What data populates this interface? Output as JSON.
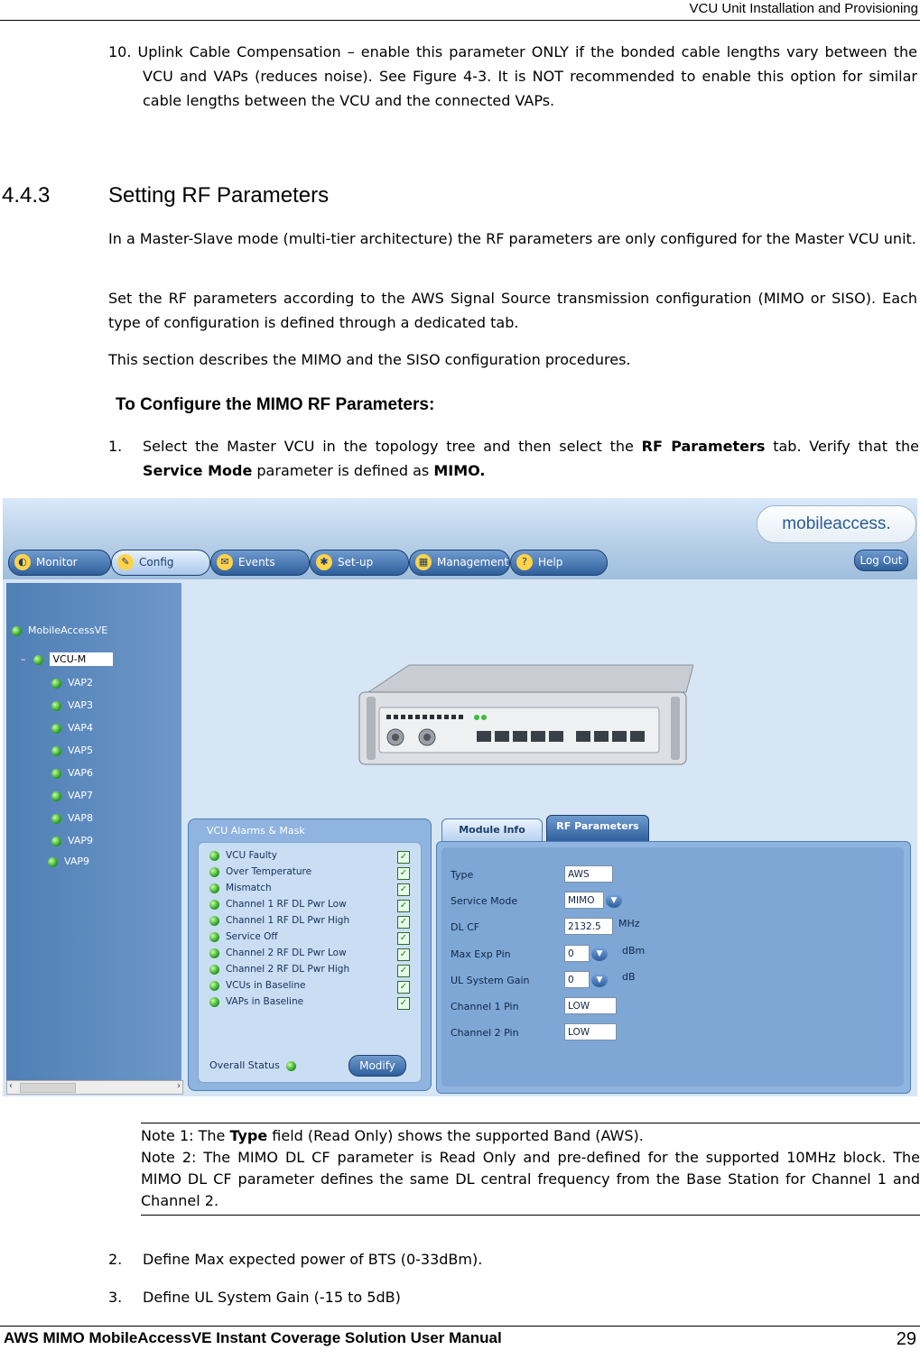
{
  "header": {
    "title": "VCU Unit Installation and Provisioning"
  },
  "step10": {
    "text": "10. Uplink Cable Compensation – enable this parameter ONLY if the bonded cable lengths vary between the VCU and VAPs (reduces noise). See Figure 4-3. It is NOT recommended to enable this option for similar cable lengths between the VCU and the connected VAPs."
  },
  "section": {
    "number": "4.4.3",
    "title": "Setting RF Parameters"
  },
  "paragraphs": [
    "In a Master-Slave mode (multi-tier architecture) the RF parameters are only configured for the Master VCU unit.",
    "Set the RF parameters according to the AWS Signal Source transmission configuration (MIMO or SISO). Each type of configuration is defined through a dedicated tab.",
    "This section describes the MIMO and the SISO configuration procedures."
  ],
  "procedure_title": "To Configure the MIMO RF Parameters:",
  "step1": {
    "num": "1.",
    "a": "Select the Master VCU in the topology tree and then select the ",
    "b": "RF Parameters",
    "c": " tab. Verify that the ",
    "d": "Service Mode",
    "e": " parameter is defined as ",
    "f": "MIMO."
  },
  "screenshot": {
    "logo": "mobileaccess.",
    "nav": [
      "Monitor",
      "Config",
      "Events",
      "Set-up",
      "Management",
      "Help"
    ],
    "logout": "Log Out",
    "tree_root": "MobileAccessVE",
    "tree_selected": "VCU-M",
    "tree_items": [
      "VAP2",
      "VAP3",
      "VAP4",
      "VAP5",
      "VAP6",
      "VAP7",
      "VAP8",
      "VAP9",
      "VAP9"
    ],
    "alarms_title": "VCU Alarms & Mask",
    "alarms": [
      "VCU Faulty",
      "Over Temperature",
      "Mismatch",
      "Channel 1 RF DL Pwr Low",
      "Channel 1 RF DL Pwr High",
      "Service Off",
      "Channel 2 RF DL Pwr Low",
      "Channel 2 RF DL Pwr High",
      "VCUs in Baseline",
      "VAPs in Baseline"
    ],
    "overall_status": "Overall Status",
    "modify": "Modify",
    "tab_module": "Module Info",
    "tab_rf": "RF Parameters",
    "rf_rows": [
      {
        "label": "Type",
        "value": "AWS",
        "unit": ""
      },
      {
        "label": "Service Mode",
        "value": "MIMO",
        "unit": ""
      },
      {
        "label": "DL CF",
        "value": "2132.5",
        "unit": "MHz"
      },
      {
        "label": "Max Exp Pin",
        "value": "0",
        "unit": "dBm"
      },
      {
        "label": "UL System Gain",
        "value": "0",
        "unit": "dB"
      },
      {
        "label": "Channel 1 Pin",
        "value": "LOW",
        "unit": ""
      },
      {
        "label": "Channel 2 Pin",
        "value": "LOW",
        "unit": ""
      }
    ]
  },
  "notes": {
    "n1a": "Note 1: The ",
    "n1b": "Type",
    "n1c": " field (Read Only) shows the supported Band (AWS).",
    "n2": "Note 2: The MIMO DL CF parameter is Read Only and pre-defined for the supported 10MHz block. The MIMO DL CF parameter defines the same DL central frequency from the Base Station for Channel 1 and Channel 2."
  },
  "step2": {
    "num": "2.",
    "text": "Define Max expected power of BTS (0-33dBm)."
  },
  "step3": {
    "num": "3.",
    "text": "Define UL System Gain (-15 to 5dB)"
  },
  "footer": {
    "title": "AWS MIMO MobileAccessVE Instant Coverage Solution User Manual",
    "page": "29"
  }
}
